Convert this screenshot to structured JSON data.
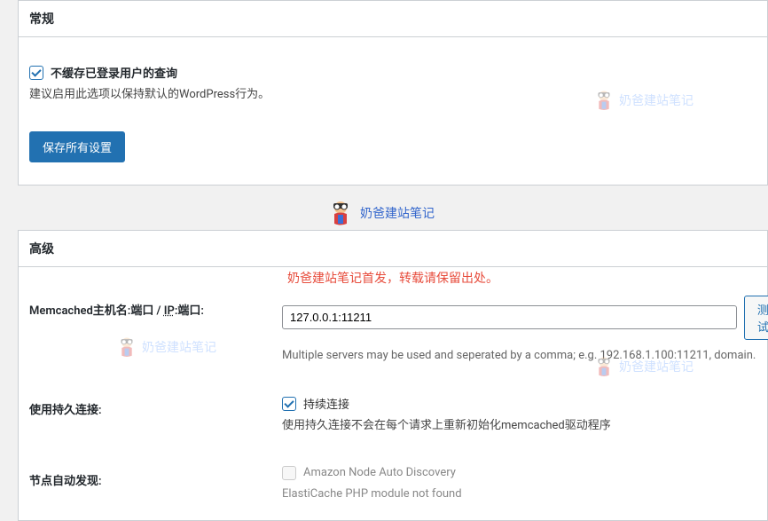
{
  "general": {
    "title": "常规",
    "checkbox_label": "不缓存已登录用户的查询",
    "desc": "建议启用此选项以保持默认的WordPress行为。",
    "save_btn": "保存所有设置"
  },
  "watermark": {
    "center_text": "奶爸建站笔记",
    "faded_text": "奶爸建站笔记",
    "red_notice": "奶爸建站笔记首发，转载请保留出处。"
  },
  "advanced": {
    "title": "高级",
    "memcached": {
      "label_prefix": "Memcached主机名:端口 / ",
      "label_ip": "IP",
      "label_suffix": ":端口:",
      "value": "127.0.0.1:11211",
      "test_btn": "测试",
      "hint": "Multiple servers may be used and seperated by a comma; e.g. 192.168.1.100:11211, domain."
    },
    "persistent": {
      "label": "使用持久连接:",
      "checkbox_label": "持续连接",
      "desc": "使用持久连接不会在每个请求上重新初始化memcached驱动程序"
    },
    "autodiscovery": {
      "label": "节点自动发现:",
      "checkbox_label": "Amazon Node Auto Discovery",
      "desc": "ElastiCache PHP module not found"
    }
  }
}
